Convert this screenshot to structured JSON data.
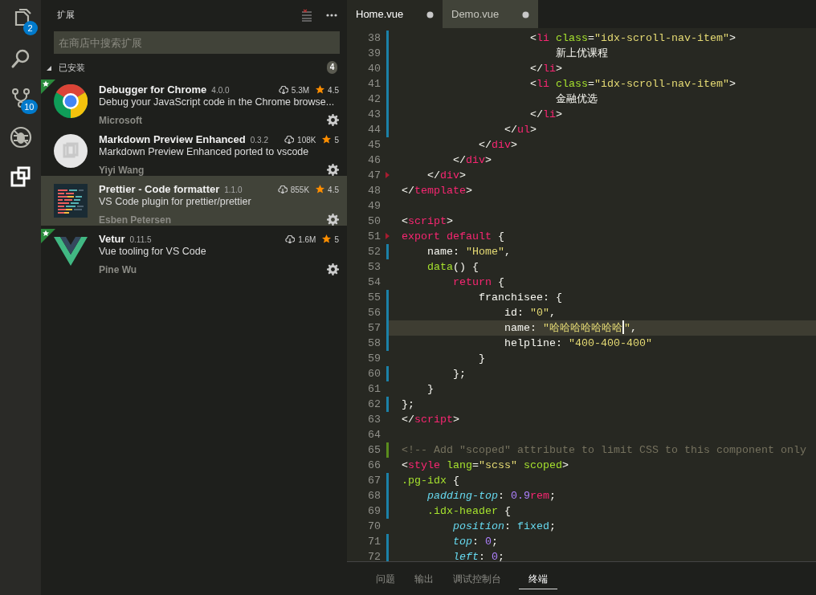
{
  "activity_bar": [
    {
      "selected": false,
      "badge": "2"
    },
    {
      "selected": false
    },
    {
      "selected": false,
      "badge": "10"
    },
    {
      "selected": false
    },
    {
      "selected": true
    }
  ],
  "sidebar": {
    "title": "扩展",
    "search": {
      "placeholder": "在商店中搜索扩展"
    },
    "section": {
      "title": "已安装",
      "count": "4",
      "expanded": true
    },
    "extensions": [
      {
        "name": "Debugger for Chrome",
        "version": "4.0.0",
        "downloads": "5.3M",
        "rating": "4.5",
        "description": "Debug your JavaScript code in the Chrome browse...",
        "author": "Microsoft",
        "featured": true,
        "selected": false
      },
      {
        "name": "Markdown Preview Enhanced",
        "version": "0.3.2",
        "downloads": "108K",
        "rating": "5",
        "description": "Markdown Preview Enhanced ported to vscode",
        "author": "Yiyi Wang",
        "featured": false,
        "selected": false
      },
      {
        "name": "Prettier - Code formatter",
        "version": "1.1.0",
        "downloads": "855K",
        "rating": "4.5",
        "description": "VS Code plugin for prettier/prettier",
        "author": "Esben Petersen",
        "featured": false,
        "selected": true
      },
      {
        "name": "Vetur",
        "version": "0.11.5",
        "downloads": "1.6M",
        "rating": "5",
        "description": "Vue tooling for VS Code",
        "author": "Pine Wu",
        "featured": true,
        "selected": false
      }
    ]
  },
  "tabs": [
    {
      "label": "Home.vue",
      "selected": true,
      "dirty": true
    },
    {
      "label": "Demo.vue",
      "selected": false,
      "dirty": true
    }
  ],
  "code_lines": [
    {
      "number": "38",
      "modified": true,
      "tokens": [
        {
          "kind": "plain",
          "text": "                    <"
        },
        {
          "kind": "tag",
          "text": "li"
        },
        {
          "kind": "attr",
          "text": " class"
        },
        {
          "kind": "plain",
          "text": "="
        },
        {
          "kind": "string",
          "text": "\"idx-scroll-nav-item\""
        },
        {
          "kind": "plain",
          "text": ">"
        }
      ]
    },
    {
      "number": "39",
      "modified": true,
      "tokens": [
        {
          "kind": "plain",
          "text": "                        新上优课程"
        }
      ]
    },
    {
      "number": "40",
      "modified": true,
      "tokens": [
        {
          "kind": "plain",
          "text": "                    </"
        },
        {
          "kind": "tag",
          "text": "li"
        },
        {
          "kind": "plain",
          "text": ">"
        }
      ]
    },
    {
      "number": "41",
      "modified": true,
      "tokens": [
        {
          "kind": "plain",
          "text": "                    <"
        },
        {
          "kind": "tag",
          "text": "li"
        },
        {
          "kind": "attr",
          "text": " class"
        },
        {
          "kind": "plain",
          "text": "="
        },
        {
          "kind": "string",
          "text": "\"idx-scroll-nav-item\""
        },
        {
          "kind": "plain",
          "text": ">"
        }
      ]
    },
    {
      "number": "42",
      "modified": true,
      "tokens": [
        {
          "kind": "plain",
          "text": "                        金融优选"
        }
      ]
    },
    {
      "number": "43",
      "modified": true,
      "tokens": [
        {
          "kind": "plain",
          "text": "                    </"
        },
        {
          "kind": "tag",
          "text": "li"
        },
        {
          "kind": "plain",
          "text": ">"
        }
      ]
    },
    {
      "number": "44",
      "modified": true,
      "tokens": [
        {
          "kind": "plain",
          "text": "                </"
        },
        {
          "kind": "tag",
          "text": "ul"
        },
        {
          "kind": "plain",
          "text": ">"
        }
      ]
    },
    {
      "number": "45",
      "tokens": [
        {
          "kind": "plain",
          "text": "            </"
        },
        {
          "kind": "tag",
          "text": "div"
        },
        {
          "kind": "plain",
          "text": ">"
        }
      ]
    },
    {
      "number": "46",
      "tokens": [
        {
          "kind": "plain",
          "text": "        </"
        },
        {
          "kind": "tag",
          "text": "div"
        },
        {
          "kind": "plain",
          "text": ">"
        }
      ]
    },
    {
      "number": "47",
      "fold_mark": true,
      "tokens": [
        {
          "kind": "plain",
          "text": "    </"
        },
        {
          "kind": "tag",
          "text": "div"
        },
        {
          "kind": "plain",
          "text": ">"
        }
      ]
    },
    {
      "number": "48",
      "tokens": [
        {
          "kind": "plain",
          "text": "</"
        },
        {
          "kind": "tag",
          "text": "template"
        },
        {
          "kind": "plain",
          "text": ">"
        }
      ]
    },
    {
      "number": "49"
    },
    {
      "number": "50",
      "tokens": [
        {
          "kind": "plain",
          "text": "<"
        },
        {
          "kind": "tag",
          "text": "script"
        },
        {
          "kind": "plain",
          "text": ">"
        }
      ]
    },
    {
      "number": "51",
      "fold_mark": true,
      "tokens": [
        {
          "kind": "tag",
          "text": "export default"
        },
        {
          "kind": "plain",
          "text": " {"
        }
      ]
    },
    {
      "number": "52",
      "modified": true,
      "tokens": [
        {
          "kind": "plain",
          "text": "    name: "
        },
        {
          "kind": "string",
          "text": "\"Home\""
        },
        {
          "kind": "plain",
          "text": ","
        }
      ]
    },
    {
      "number": "53",
      "tokens": [
        {
          "kind": "attr",
          "text": "    data"
        },
        {
          "kind": "plain",
          "text": "() {"
        }
      ]
    },
    {
      "number": "54",
      "tokens": [
        {
          "kind": "tag",
          "text": "        return"
        },
        {
          "kind": "plain",
          "text": " {"
        }
      ]
    },
    {
      "number": "55",
      "modified": true,
      "tokens": [
        {
          "kind": "plain",
          "text": "            franchisee: {"
        }
      ]
    },
    {
      "number": "56",
      "modified": true,
      "tokens": [
        {
          "kind": "plain",
          "text": "                id: "
        },
        {
          "kind": "string",
          "text": "\"0\""
        },
        {
          "kind": "plain",
          "text": ","
        }
      ]
    },
    {
      "number": "57",
      "modified": true,
      "current": true,
      "tokens": [
        {
          "kind": "plain",
          "text": "                name: "
        },
        {
          "kind": "string-caret",
          "text": "\"哈哈哈哈哈哈哈"
        },
        {
          "kind": "string",
          "text": "\""
        },
        {
          "kind": "plain",
          "text": ","
        }
      ]
    },
    {
      "number": "58",
      "modified": true,
      "tokens": [
        {
          "kind": "plain",
          "text": "                helpline: "
        },
        {
          "kind": "string",
          "text": "\"400-400-400\""
        }
      ]
    },
    {
      "number": "59",
      "tokens": [
        {
          "kind": "plain",
          "text": "            }"
        }
      ]
    },
    {
      "number": "60",
      "modified": true,
      "tokens": [
        {
          "kind": "plain",
          "text": "        };"
        }
      ]
    },
    {
      "number": "61",
      "tokens": [
        {
          "kind": "plain",
          "text": "    }"
        }
      ]
    },
    {
      "number": "62",
      "modified": true,
      "tokens": [
        {
          "kind": "plain",
          "text": "};"
        }
      ]
    },
    {
      "number": "63",
      "tokens": [
        {
          "kind": "plain",
          "text": "</"
        },
        {
          "kind": "tag",
          "text": "script"
        },
        {
          "kind": "plain",
          "text": ">"
        }
      ]
    },
    {
      "number": "64"
    },
    {
      "number": "65",
      "added": true,
      "tokens": [
        {
          "kind": "comment",
          "text": "<!-- Add \"scoped\" attribute to limit CSS to this component only"
        }
      ]
    },
    {
      "number": "66",
      "tokens": [
        {
          "kind": "plain",
          "text": "<"
        },
        {
          "kind": "tag",
          "text": "style"
        },
        {
          "kind": "attr",
          "text": " lang"
        },
        {
          "kind": "plain",
          "text": "="
        },
        {
          "kind": "string",
          "text": "\"scss\""
        },
        {
          "kind": "attr",
          "text": " scoped"
        },
        {
          "kind": "plain",
          "text": ">"
        }
      ]
    },
    {
      "number": "67",
      "modified": true,
      "tokens": [
        {
          "kind": "attr",
          "text": ".pg-idx"
        },
        {
          "kind": "plain",
          "text": " {"
        }
      ]
    },
    {
      "number": "68",
      "modified": true,
      "tokens": [
        {
          "kind": "prop",
          "text": "    padding-top"
        },
        {
          "kind": "plain",
          "text": ": "
        },
        {
          "kind": "number",
          "text": "0.9"
        },
        {
          "kind": "tag",
          "text": "rem"
        },
        {
          "kind": "plain",
          "text": ";"
        }
      ]
    },
    {
      "number": "69",
      "modified": true,
      "tokens": [
        {
          "kind": "attr",
          "text": "    .idx-header"
        },
        {
          "kind": "plain",
          "text": " {"
        }
      ]
    },
    {
      "number": "70",
      "tokens": [
        {
          "kind": "prop",
          "text": "        position"
        },
        {
          "kind": "plain",
          "text": ": "
        },
        {
          "kind": "value",
          "text": "fixed"
        },
        {
          "kind": "plain",
          "text": ";"
        }
      ]
    },
    {
      "number": "71",
      "modified": true,
      "tokens": [
        {
          "kind": "prop",
          "text": "        top"
        },
        {
          "kind": "plain",
          "text": ": "
        },
        {
          "kind": "number",
          "text": "0"
        },
        {
          "kind": "plain",
          "text": ";"
        }
      ]
    },
    {
      "number": "72",
      "modified": true,
      "tokens": [
        {
          "kind": "prop",
          "text": "        left"
        },
        {
          "kind": "plain",
          "text": ": "
        },
        {
          "kind": "number",
          "text": "0"
        },
        {
          "kind": "plain",
          "text": ";"
        }
      ]
    }
  ],
  "panel_tabs": [
    {
      "label": "问题",
      "selected": false
    },
    {
      "label": "输出",
      "selected": false
    },
    {
      "label": "调试控制台",
      "selected": false
    },
    {
      "label": "终端",
      "selected": true
    }
  ]
}
